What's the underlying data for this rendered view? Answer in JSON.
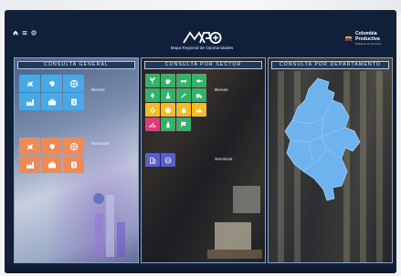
{
  "nav": {
    "icons": [
      "home-icon",
      "menu-icon",
      "settings-icon"
    ]
  },
  "brand": {
    "logo_text": "MRO",
    "subtitle": "Mapa Regional de Oportunidades",
    "partner_name_line1": "Colombia",
    "partner_name_line2": "Productiva",
    "partner_tagline": "Ministerio de Comercio"
  },
  "panels": [
    {
      "title": "CONSULTA GENERAL",
      "groups": [
        {
          "label": "Bienes",
          "color": "#48a9e6",
          "icons": [
            "bull-icon",
            "cow-icon",
            "globe-icon",
            "factory-icon",
            "briefcase-icon",
            "dollar-icon"
          ]
        },
        {
          "label": "Servicios",
          "color": "#f08a55",
          "icons": [
            "bull-icon",
            "cow-icon",
            "globe-icon",
            "factory-icon",
            "briefcase-icon",
            "dollar-icon"
          ]
        }
      ]
    },
    {
      "title": "CONSULTA POR SECTOR",
      "groups": [
        {
          "label": "Bienes",
          "icons": [
            "plant-icon",
            "cup-icon",
            "cow-icon",
            "fish-icon",
            "tree-icon",
            "chemistry-icon",
            "tools-icon",
            "truck-icon",
            "gear-icon",
            "printer-icon",
            "oil-icon",
            "machine-icon",
            "hanger-icon",
            "bottle-icon",
            "flag-icon"
          ]
        },
        {
          "label": "Servicios",
          "icons": [
            "building-icon",
            "globe-icon"
          ]
        }
      ]
    },
    {
      "title": "CONSULTA POR DEPARTAMENTO",
      "map": "colombia-map"
    }
  ],
  "colors": {
    "background": "#10203a",
    "blue_tile": "#48a9e6",
    "orange_tile": "#f08a55",
    "green_tile": "#33b36a",
    "yellow_tile": "#f5bb22",
    "pink_tile": "#e2387c",
    "violet_tile": "#5b5fc7",
    "map_fill": "#6fb3ee"
  }
}
